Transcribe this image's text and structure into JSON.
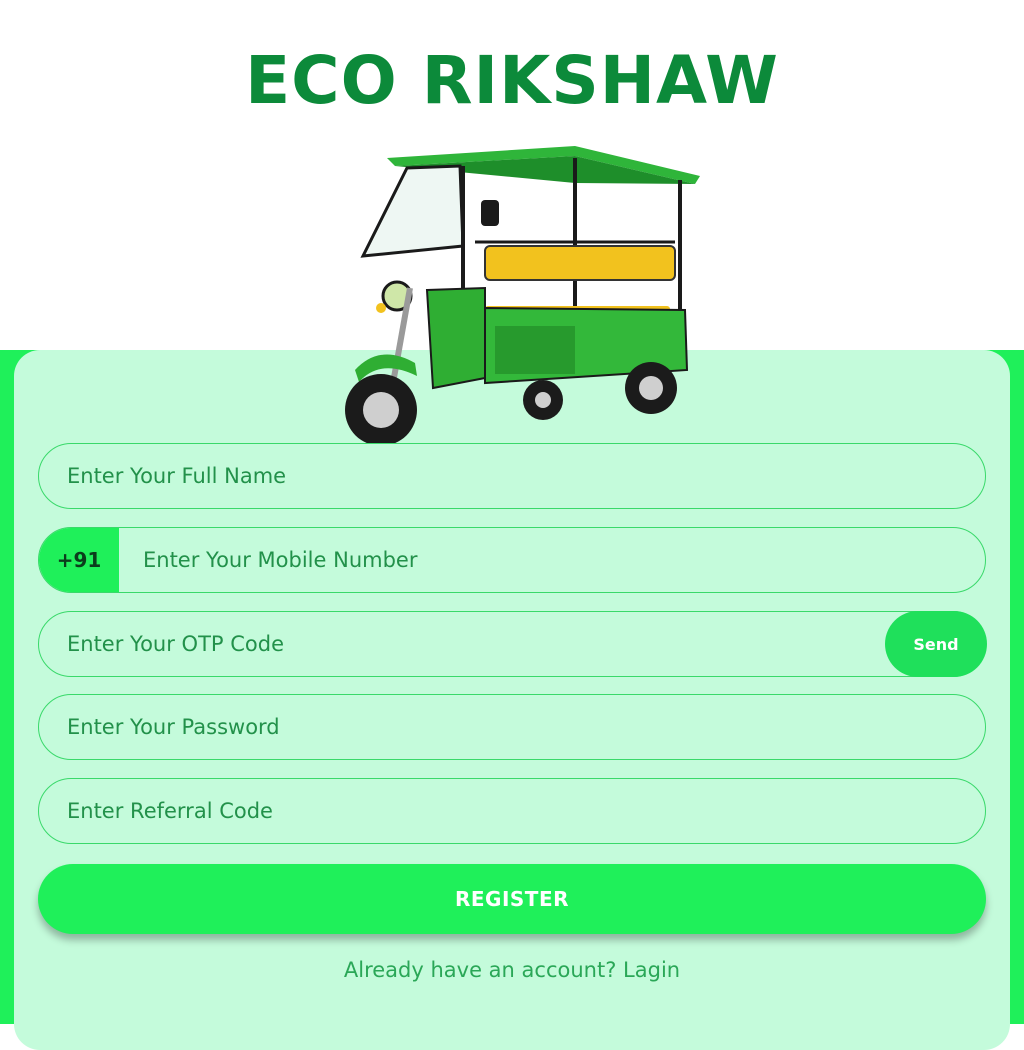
{
  "brand": {
    "title": "ECO RIKSHAW",
    "title_color": "#0c8a3a",
    "accent_color": "#1ff05a",
    "panel_color": "#c4fbdb"
  },
  "hero_image": {
    "icon": "e-rickshaw-illustration"
  },
  "form": {
    "full_name": {
      "placeholder": "Enter Your Full Name",
      "value": ""
    },
    "mobile": {
      "country_code": "+91",
      "placeholder": "Enter Your Mobile Number",
      "value": ""
    },
    "otp": {
      "placeholder": "Enter Your OTP Code",
      "value": "",
      "send_label": "Send"
    },
    "password": {
      "placeholder": "Enter Your Password",
      "value": ""
    },
    "referral": {
      "placeholder": "Enter Referral Code",
      "value": ""
    },
    "register_label": "REGISTER"
  },
  "footer": {
    "prompt": "Already have an account?",
    "login_label": "Lagin"
  }
}
